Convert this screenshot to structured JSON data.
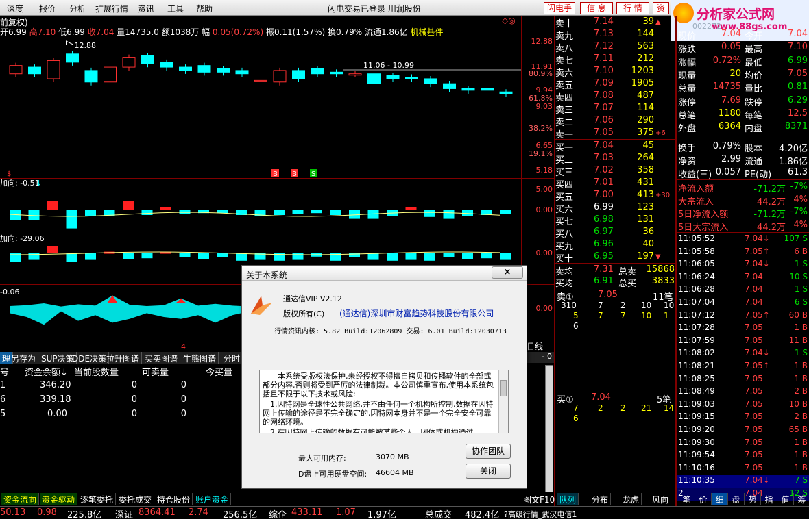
{
  "menu": {
    "items": [
      "深度",
      "报价",
      "分析",
      "扩展行情",
      "资讯",
      "工具",
      "帮助"
    ],
    "center": "闪电交易已登录  川润股份",
    "buttons": [
      "闪电手",
      "信 息",
      "行 情",
      "资"
    ]
  },
  "logo": {
    "text": "分析家公式网",
    "url": "www.88gs.com",
    "code": "002272"
  },
  "chart": {
    "title": "前复权)",
    "mark": "◇◎",
    "info": [
      {
        "t": "开6.99",
        "c": "wh"
      },
      {
        "t": "高7.10",
        "c": "rt"
      },
      {
        "t": "低6.99",
        "c": "wh"
      },
      {
        "t": "收7.04",
        "c": "rt"
      },
      {
        "t": "量14735.0",
        "c": "wh"
      },
      {
        "t": "额1038万",
        "c": "wh"
      },
      {
        "t": "幅",
        "c": "wh"
      },
      {
        "t": "0.05(0.72%)",
        "c": "rt"
      },
      {
        "t": "振0.11(1.57%)",
        "c": "wh"
      },
      {
        "t": "换0.79%",
        "c": "wh"
      },
      {
        "t": "流通1.86亿",
        "c": "wh"
      },
      {
        "t": "机械基件",
        "c": "ye"
      }
    ],
    "high_label": "12.88",
    "range_label": "11.06 - 10.99",
    "price_axis": [
      "12.88",
      "11.91",
      "80.9%",
      "9.94",
      "61.8%",
      "9.03",
      "38.2%",
      "6.65",
      "19.1%",
      "5.18"
    ],
    "ind1": {
      "label": "加向: -0.51",
      "axis": [
        "5.00",
        "0.00"
      ]
    },
    "ind2": {
      "label": "加向: -29.06",
      "axis": [
        "0.00"
      ]
    },
    "ind3": {
      "label": "-0.06",
      "axis": [
        "0.00"
      ]
    },
    "bs_marks": [
      "B",
      "B",
      "S"
    ],
    "mark4": "4",
    "mark_s": "$"
  },
  "candles": [
    {
      "o": 10.9,
      "c": 11.4
    },
    {
      "o": 11.3,
      "c": 10.9
    },
    {
      "o": 10.6,
      "c": 11.7
    },
    {
      "o": 12.1,
      "c": 11.6
    },
    {
      "o": 11.1,
      "c": 10.4
    },
    {
      "o": 10.4,
      "c": 11.3
    },
    {
      "o": 11.3,
      "c": 11.9
    },
    {
      "o": 12.0,
      "c": 11.5
    },
    {
      "o": 11.6,
      "c": 11.3
    },
    {
      "o": 11.3,
      "c": 11.1
    },
    {
      "o": 11.4,
      "c": 11.0
    },
    {
      "o": 11.2,
      "c": 11.0
    },
    {
      "o": 11.1,
      "c": 10.9
    },
    {
      "o": 10.5,
      "c": 10.5
    },
    {
      "o": 10.4,
      "c": 11.1
    },
    {
      "o": 11.1,
      "c": 10.6
    },
    {
      "o": 11.2,
      "c": 10.9
    },
    {
      "o": 11.0,
      "c": 10.9
    },
    {
      "o": 10.9,
      "c": 10.9
    },
    {
      "o": 10.9,
      "c": 10.3
    },
    {
      "o": 10.8,
      "c": 10.6
    },
    {
      "o": 10.7,
      "c": 10.6
    },
    {
      "o": 10.6,
      "c": 10.3
    },
    {
      "o": 10.3,
      "c": 10.0
    },
    {
      "o": 10.0,
      "c": 9.9
    },
    {
      "o": 10.0,
      "c": 9.9
    },
    {
      "o": 9.8,
      "c": 9.7
    }
  ],
  "ind1_vals": [
    -1.0,
    -1.0,
    1.0,
    -1.9,
    -0.6,
    -0.6,
    1.0,
    -0.5,
    0.3,
    -0.4,
    -0.3,
    -0.3,
    -0.5,
    -0.6,
    -0.5,
    -0.4,
    -0.3,
    -0.5,
    -0.9,
    -0.9,
    -0.6,
    0.3,
    -0.7,
    -0.9,
    -0.6,
    -0.5,
    -0.4
  ],
  "ind2_vals": [
    -1.0,
    -0.8,
    0.9,
    -1.0,
    -0.8,
    0.2,
    -0.7,
    -0.6,
    0.2,
    -0.5,
    -0.7,
    -0.5,
    -0.9,
    -0.8,
    -0.9,
    -0.8,
    -0.4,
    -0.9,
    -0.5,
    -0.8,
    -0.9,
    -0.8,
    -0.9,
    -0.5,
    -0.7,
    -0.6,
    -0.8
  ],
  "ind3_vals": [
    -0.3,
    -0.5,
    -0.9,
    -0.2,
    -0.7,
    -0.4,
    0.8,
    -0.6,
    -0.3,
    -0.5,
    0.6,
    -0.4,
    -0.8,
    -0.4,
    -0.2
  ],
  "order": {
    "sell": [
      {
        "n": "卖十",
        "p": "7.14",
        "v": "39",
        "x": "▲"
      },
      {
        "n": "卖九",
        "p": "7.13",
        "v": "144",
        "x": ""
      },
      {
        "n": "卖八",
        "p": "7.12",
        "v": "563",
        "x": ""
      },
      {
        "n": "卖七",
        "p": "7.11",
        "v": "212",
        "x": ""
      },
      {
        "n": "卖六",
        "p": "7.10",
        "v": "1203",
        "x": ""
      },
      {
        "n": "卖五",
        "p": "7.09",
        "v": "1905",
        "x": ""
      },
      {
        "n": "卖四",
        "p": "7.08",
        "v": "487",
        "x": ""
      },
      {
        "n": "卖三",
        "p": "7.07",
        "v": "114",
        "x": ""
      },
      {
        "n": "卖二",
        "p": "7.06",
        "v": "290",
        "x": ""
      },
      {
        "n": "卖一",
        "p": "7.05",
        "v": "375",
        "x": "+6"
      }
    ],
    "buy": [
      {
        "n": "买一",
        "p": "7.04",
        "v": "45",
        "x": "",
        "pc": "rt"
      },
      {
        "n": "买二",
        "p": "7.03",
        "v": "264",
        "x": "",
        "pc": "rt"
      },
      {
        "n": "买三",
        "p": "7.02",
        "v": "358",
        "x": "",
        "pc": "rt"
      },
      {
        "n": "买四",
        "p": "7.01",
        "v": "431",
        "x": "",
        "pc": "rt"
      },
      {
        "n": "买五",
        "p": "7.00",
        "v": "413",
        "x": "+30",
        "pc": "rt"
      },
      {
        "n": "买六",
        "p": "6.99",
        "v": "123",
        "x": "",
        "pc": "wh"
      },
      {
        "n": "买七",
        "p": "6.98",
        "v": "131",
        "x": "",
        "pc": "gr"
      },
      {
        "n": "买八",
        "p": "6.97",
        "v": "36",
        "x": "",
        "pc": "gr"
      },
      {
        "n": "买九",
        "p": "6.96",
        "v": "40",
        "x": "",
        "pc": "gr"
      },
      {
        "n": "买十",
        "p": "6.95",
        "v": "197",
        "x": "▼",
        "pc": "gr"
      }
    ],
    "avg": [
      {
        "n": "卖均",
        "p": "7.31",
        "t": "总卖",
        "v": "15868"
      },
      {
        "n": "买均",
        "p": "6.91",
        "t": "总买",
        "v": "3833"
      }
    ],
    "sell1": {
      "label": "卖①",
      "price": "7.05",
      "count": "11笔",
      "row1": [
        "310",
        "7",
        "2",
        "10",
        "10"
      ],
      "row2": [
        "5",
        "7",
        "7",
        "10",
        "1"
      ],
      "row3": [
        "6"
      ]
    },
    "buy1": {
      "label": "买①",
      "price": "7.04",
      "count": "5笔",
      "row1": [
        "7",
        "2",
        "2",
        "21",
        "14"
      ],
      "row2": [
        "6"
      ]
    },
    "line_tab": "日线"
  },
  "stats": {
    "rows": [
      [
        "现价",
        "7.04",
        "今开",
        "7.04"
      ],
      [
        "涨跌",
        "0.05",
        "最高",
        "7.10"
      ],
      [
        "涨幅",
        "0.72%",
        "最低",
        "6.99"
      ],
      [
        "现量",
        "20",
        "均价",
        "7.05"
      ],
      [
        "总量",
        "14735",
        "量比",
        "0.81"
      ],
      [
        "涨停",
        "7.69",
        "跌停",
        "6.29"
      ],
      [
        "总笔",
        "1180",
        "每笔",
        "12.5"
      ],
      [
        "外盘",
        "6364",
        "内盘",
        "8371"
      ]
    ],
    "rows2": [
      [
        "换手",
        "0.79%",
        "股本",
        "4.20亿"
      ],
      [
        "净资",
        "2.99",
        "流通",
        "1.86亿"
      ],
      [
        "收益(三)",
        "0.057",
        "PE(动)",
        "61.3"
      ]
    ],
    "flow": [
      [
        "净流入额",
        "-71.2万",
        "-7%"
      ],
      [
        "大宗流入",
        "44.2万",
        "4%"
      ],
      [
        "5日净流入额",
        "-71.2万",
        "-7%"
      ],
      [
        "5日大宗流入",
        "44.2万",
        "4%"
      ]
    ]
  },
  "ticks": [
    [
      "11:05:52",
      "7.04↓",
      "107 S"
    ],
    [
      "11:05:58",
      "7.05↑",
      "6 B"
    ],
    [
      "11:06:05",
      "7.04↓",
      "1 S"
    ],
    [
      "11:06:24",
      "7.04",
      "10 S"
    ],
    [
      "11:06:28",
      "7.04",
      "1 S"
    ],
    [
      "11:07:04",
      "7.04",
      "6 S"
    ],
    [
      "11:07:12",
      "7.05↑",
      "60 B"
    ],
    [
      "11:07:28",
      "7.05",
      "1 B"
    ],
    [
      "11:07:59",
      "7.05",
      "11 B"
    ],
    [
      "11:08:02",
      "7.04↓",
      "1 S"
    ],
    [
      "11:08:21",
      "7.05↑",
      "1 B"
    ],
    [
      "11:08:25",
      "7.05",
      "1 B"
    ],
    [
      "11:08:49",
      "7.05",
      "2 B"
    ],
    [
      "11:09:03",
      "7.05",
      "10 B"
    ],
    [
      "11:09:15",
      "7.05",
      "2 B"
    ],
    [
      "11:09:20",
      "7.05",
      "65 B"
    ],
    [
      "11:09:30",
      "7.05",
      "1 B"
    ],
    [
      "11:09:54",
      "7.05",
      "1 B"
    ],
    [
      "11:10:16",
      "7.05",
      "1 B"
    ],
    [
      "11:10:35",
      "7.04↓",
      "7 S"
    ],
    [
      "2",
      "7.04",
      "12 S"
    ]
  ],
  "bottom_table": {
    "tabs": [
      "理",
      "另存为",
      "SUP决策",
      "DDE决策",
      "拉升图谱",
      "买卖图谱",
      "牛熊图谱",
      "分时"
    ],
    "headers": [
      "号",
      "资金余额↓",
      "当前股数量",
      "可卖量",
      "今买量"
    ],
    "rows": [
      [
        "1",
        "346.20",
        "0",
        "0",
        "—"
      ],
      [
        "6",
        "339.18",
        "0",
        "0",
        "—"
      ],
      [
        "5",
        "0.00",
        "0",
        "0",
        "—"
      ]
    ],
    "bottom_tabs": [
      "资金流向",
      "资金驱动",
      "逐笔委托",
      "委托成交",
      "持仓股份",
      "账户资金"
    ],
    "right_tabs": [
      "图文F10",
      "队列",
      "分布",
      "龙虎",
      "风向"
    ],
    "tick_tabs": [
      "笔",
      "价",
      "细",
      "盘",
      "势",
      "指",
      "值",
      "筹"
    ]
  },
  "status": {
    "items": [
      {
        "t": "50.13",
        "c": "rt"
      },
      {
        "t": "0.98",
        "c": "rt"
      },
      {
        "t": "225.8亿",
        "c": "wh"
      },
      {
        "t": "深证",
        "c": "wh"
      },
      {
        "t": "8364.41",
        "c": "rt"
      },
      {
        "t": "2.74",
        "c": "rt"
      },
      {
        "t": "256.5亿",
        "c": "wh"
      },
      {
        "t": "综企",
        "c": "wh"
      },
      {
        "t": "433.11",
        "c": "rt"
      },
      {
        "t": "1.07",
        "c": "rt"
      },
      {
        "t": "1.97亿",
        "c": "wh"
      },
      {
        "t": "总成交",
        "c": "wh"
      },
      {
        "t": "482.4亿",
        "c": "wh"
      },
      {
        "t": "?高级行情_武汉电信1",
        "c": "wh"
      }
    ]
  },
  "dialog": {
    "title": "关于本系统",
    "close": "×",
    "product": "通达信VIP V2.12",
    "copyright_label": "版权所有(C)",
    "company": "(通达信)深圳市财富趋势科技股份有限公司",
    "version": "行情资讯内核: 5.82 Build:12062809 交易: 6.01 Build:12030713",
    "text": [
      "本系统受版权法保护,未经授权不得擅自拷贝和传播软件的全部或部分内容,否则将受到严厉的法律制裁。本公司慎重宣布,使用本系统包括且不限于以下技术或风险:",
      "1.因特网是全球性公共网络,并不由任何一个机构所控制,数据在因特网上传输的途径是不完全确定的,因特网本身并不是一个完全安全可靠的网络环境。",
      "2.在因特网上传输的数据有可能被某些个人、团体或机构通过"
    ],
    "mem_label": "最大可用内存:",
    "mem_val": "3070 MB",
    "disk_label": "D盘上可用硬盘空间:",
    "disk_val": "46604 MB",
    "team_btn": "协作团队",
    "close_btn": "关闭"
  }
}
